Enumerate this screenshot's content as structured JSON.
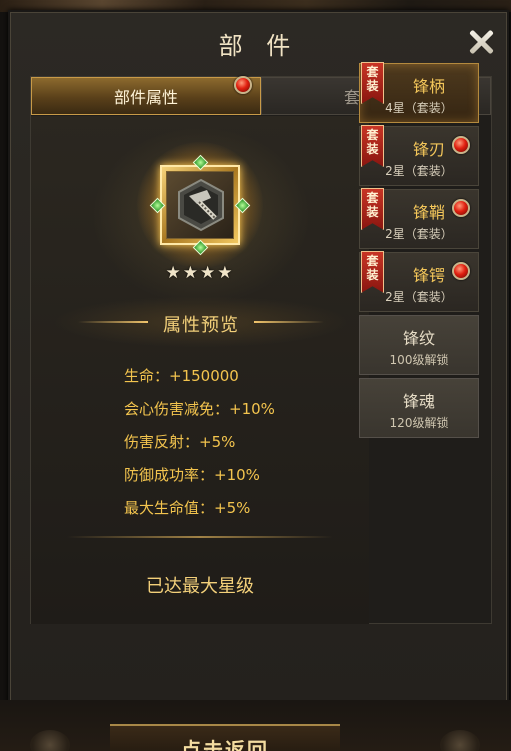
{
  "window": {
    "title": "部 件"
  },
  "tabs": [
    {
      "label": "部件属性",
      "active": true,
      "has_alert": true
    },
    {
      "label": "套装属性",
      "active": false,
      "has_alert": false
    }
  ],
  "part": {
    "icon": "hammer-emblem-icon",
    "stars_text": "★★★★",
    "star_count": 4
  },
  "preview": {
    "title": "属性预览",
    "attributes": [
      "生命：+150000",
      "会心伤害减免：+10%",
      "伤害反射：+5%",
      "防御成功率：+10%",
      "最大生命值：+5%"
    ],
    "status": "已达最大星级"
  },
  "parts_list": [
    {
      "badge": "套装",
      "name": "锋柄",
      "sub": "4星（套装）",
      "selected": true,
      "alert": false
    },
    {
      "badge": "套装",
      "name": "锋刃",
      "sub": "2星（套装）",
      "selected": false,
      "alert": true
    },
    {
      "badge": "套装",
      "name": "锋鞘",
      "sub": "2星（套装）",
      "selected": false,
      "alert": true
    },
    {
      "badge": "套装",
      "name": "锋锷",
      "sub": "2星（套装）",
      "selected": false,
      "alert": true
    },
    {
      "name": "锋纹",
      "sub": "100级解锁",
      "locked": true
    },
    {
      "name": "锋魂",
      "sub": "120级解锁",
      "locked": true
    }
  ],
  "bottom": {
    "back_label": "点击返回"
  },
  "colors": {
    "accent_gold": "#f3c44e",
    "alert_red": "#e12010",
    "badge_red": "#c83525"
  }
}
